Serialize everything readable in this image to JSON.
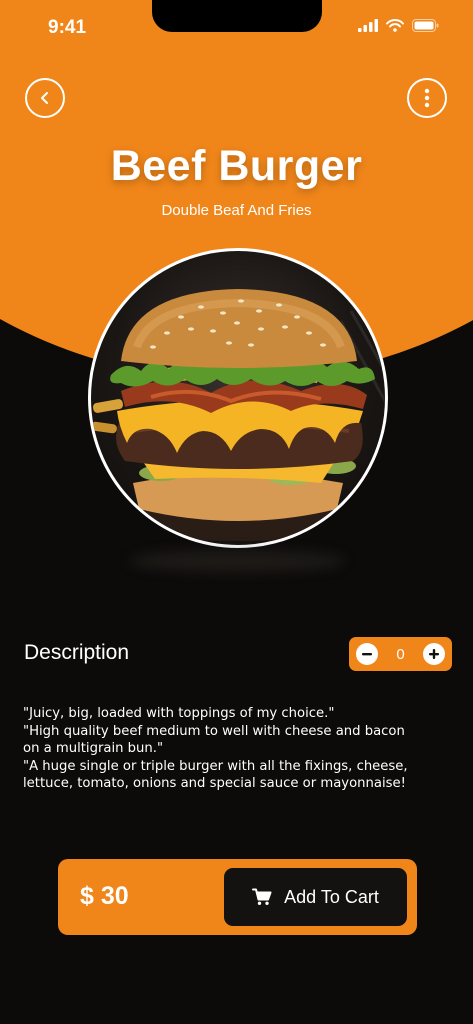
{
  "status_bar": {
    "time": "9:41"
  },
  "header": {
    "back_icon": "chevron-left-icon",
    "more_icon": "more-vertical-icon"
  },
  "product": {
    "title": "Beef Burger",
    "subtitle": "Double Beaf And Fries"
  },
  "description": {
    "heading": "Description",
    "quantity": "0",
    "lines": [
      "\"Juicy, big, loaded with toppings of my choice.\"",
      "\"High quality beef medium to well with cheese and bacon on a multigrain bun.\"",
      "\"A huge single or triple burger with all the fixings, cheese, lettuce, tomato, onions and special sauce or mayonnaise!"
    ]
  },
  "cart": {
    "price": "$ 30",
    "add_label": "Add To Cart",
    "cart_icon": "cart-icon"
  },
  "colors": {
    "accent": "#f0861a",
    "background": "#0d0b0a",
    "button_dark": "#141210"
  }
}
